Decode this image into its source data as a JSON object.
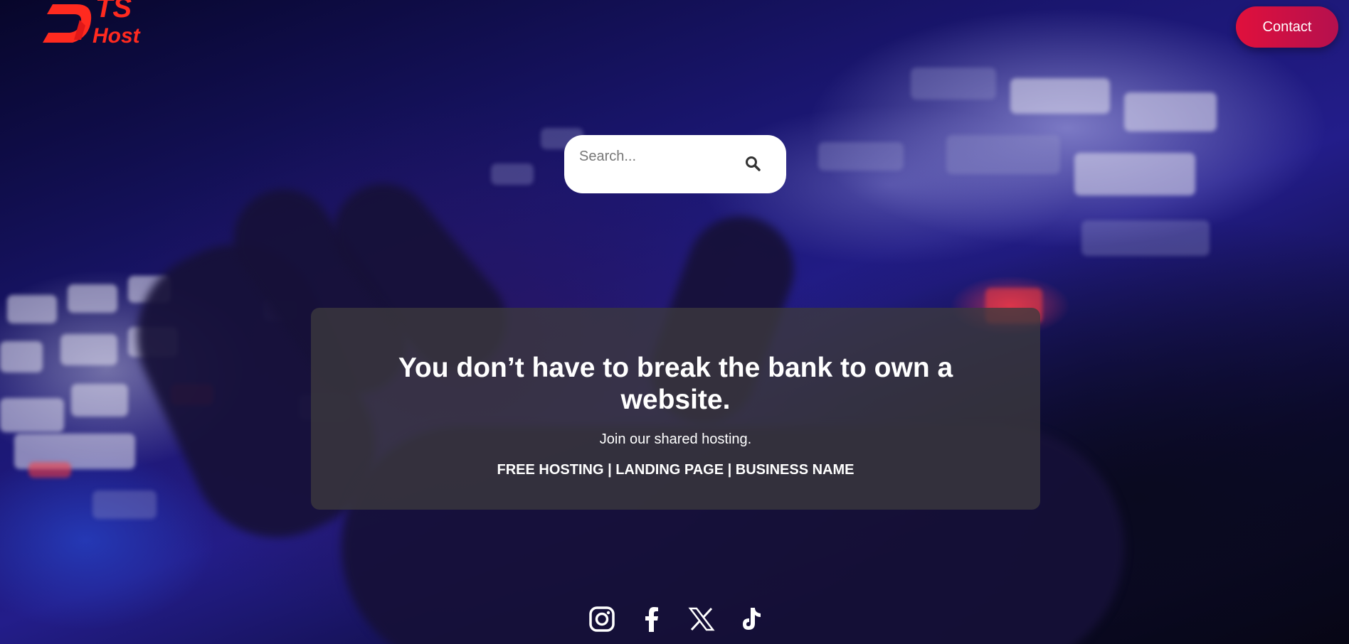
{
  "header": {
    "logo_text_top": "TS",
    "logo_text_bottom": "Host",
    "contact_label": "Contact"
  },
  "search": {
    "placeholder": "Search..."
  },
  "hero": {
    "title": "You don’t have to break the bank to own a website.",
    "subtitle": "Join our shared hosting.",
    "links": "FREE HOSTING | LANDING PAGE | BUSINESS NAME"
  },
  "social": [
    {
      "icon": "instagram-icon"
    },
    {
      "icon": "facebook-icon"
    },
    {
      "icon": "x-icon"
    },
    {
      "icon": "tiktok-icon"
    }
  ],
  "colors": {
    "accent": "#e0103c",
    "logo": "#ff2a1f",
    "card_bg": "#3c3a3e"
  }
}
